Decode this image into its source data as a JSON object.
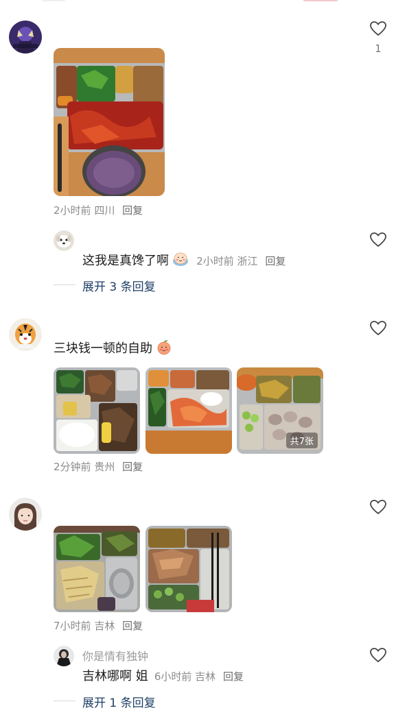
{
  "comments": [
    {
      "meta": {
        "time": "2小时前",
        "location": "四川",
        "reply": "回复"
      },
      "likes": "1",
      "subreply": {
        "text": "这我是真馋了啊",
        "meta": {
          "time": "2小时前",
          "location": "浙江",
          "reply": "回复"
        }
      },
      "expand": "展开 3 条回复"
    },
    {
      "text": "三块钱一顿的自助",
      "image_count": "共7张",
      "meta": {
        "time": "2分钟前",
        "location": "贵州",
        "reply": "回复"
      }
    },
    {
      "meta": {
        "time": "7小时前",
        "location": "吉林",
        "reply": "回复"
      },
      "subreply": {
        "username": "你是情有独钟",
        "text": "吉林哪啊 姐",
        "meta": {
          "time": "6小时前",
          "location": "吉林",
          "reply": "回复"
        }
      },
      "expand": "展开 1 条回复"
    }
  ],
  "colors": {
    "link": "#1f3f66",
    "meta": "#8a8a8a",
    "heart": "#444444"
  },
  "icons": [
    "heart-icon",
    "blushing-emoji-icon",
    "peach-emoji-icon"
  ]
}
